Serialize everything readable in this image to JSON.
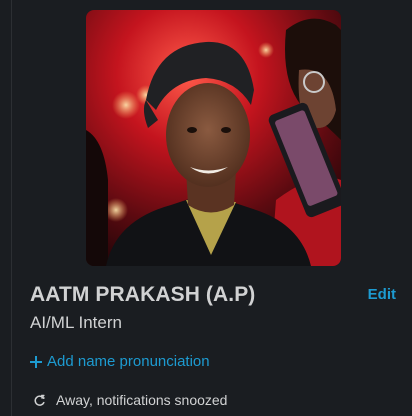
{
  "profile": {
    "name": "AATM PRAKASH (A.P)",
    "title": "AI/ML Intern",
    "edit_label": "Edit",
    "add_pronunciation_label": "Add name pronunciation",
    "status_text": "Away, notifications snoozed"
  },
  "icons": {
    "add": "plus-icon",
    "status": "snooze-icon"
  },
  "colors": {
    "background": "#1a1d21",
    "text": "#d1d2d3",
    "link": "#1d9bd1"
  }
}
